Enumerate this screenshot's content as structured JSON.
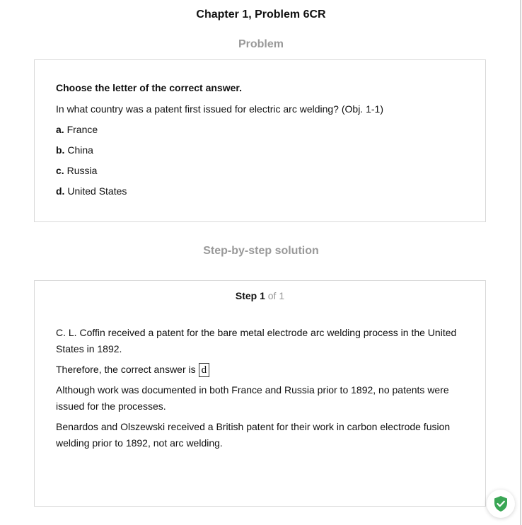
{
  "page": {
    "title": "Chapter 1, Problem 6CR"
  },
  "problem": {
    "heading": "Problem",
    "instruction": "Choose the letter of the correct answer.",
    "question": "In what country was a patent first issued for electric arc welding? (Obj. 1-1)",
    "choices": [
      {
        "letter": "a.",
        "text": "France"
      },
      {
        "letter": "b.",
        "text": "China"
      },
      {
        "letter": "c.",
        "text": "Russia"
      },
      {
        "letter": "d.",
        "text": "United States"
      }
    ]
  },
  "solution": {
    "heading": "Step-by-step solution",
    "step_label": "Step 1",
    "step_of": "of 1",
    "paragraph1": "C. L. Coffin received a patent for the bare metal electrode arc welding process in the United States in 1892.",
    "answer_prefix": "Therefore, the correct answer is",
    "answer_value": "d",
    "paragraph3": "Although work was documented in both France and Russia prior to 1892, no patents were issued for the processes.",
    "paragraph4": "Benardos and Olszewski received a British patent for their work in carbon electrode fusion welding prior to 1892, not arc welding."
  },
  "widget": {
    "icon": "shield-check-icon",
    "accent": "#3aa655"
  }
}
